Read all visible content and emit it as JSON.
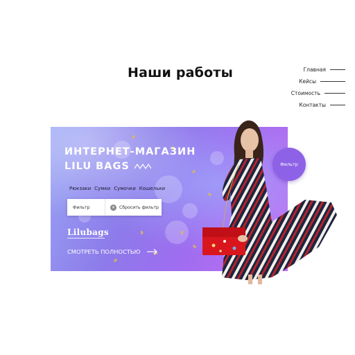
{
  "header": {
    "title": "Наши работы"
  },
  "nav": {
    "items": [
      {
        "label": "Главная"
      },
      {
        "label": "Кейсы"
      },
      {
        "label": "Стоимость"
      },
      {
        "label": "Контакты"
      }
    ]
  },
  "banner": {
    "heading_line1": "ИНТЕРНЕТ-МАГАЗИН",
    "heading_line2": "LILU BAGS",
    "categories": [
      "Рюкзаки",
      "Сумки",
      "Сумочки",
      "Кошельки"
    ],
    "filter_label": "Фильтр",
    "reset_label": "Сбросить фильтр",
    "logo": "Lilubags",
    "cta_label": "СМОТРЕТЬ ПОЛНОСТЬЮ",
    "filter_button_label": "Фильтр"
  },
  "colors": {
    "accent": "#8e62e6",
    "bag": "#d9161d",
    "text_dark": "#111111"
  },
  "icons": [
    "zigzag-icon",
    "close-icon",
    "arrow-right-icon"
  ]
}
